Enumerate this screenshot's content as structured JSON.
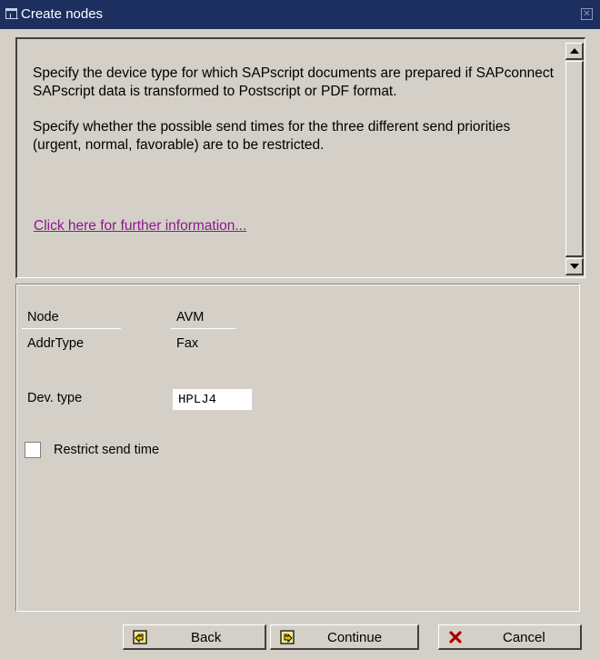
{
  "window": {
    "title": "Create nodes"
  },
  "info": {
    "paragraph1": "Specify the device type for which SAPscript documents are prepared if SAPconnect SAPscript data is transformed to Postscript or PDF format.",
    "paragraph2": "Specify whether the possible send times for the three different send priorities (urgent, normal, favorable) are to be restricted.",
    "link": "Click here for further information..."
  },
  "form": {
    "node_label": "Node",
    "node_value": "AVM",
    "addrtype_label": "AddrType",
    "addrtype_value": "Fax",
    "devtype_label": "Dev. type",
    "devtype_value": "HPLJ4",
    "restrict_label": "Restrict send time",
    "restrict_checked": false
  },
  "buttons": {
    "back": "Back",
    "continue": "Continue",
    "cancel": "Cancel"
  },
  "colors": {
    "titlebar": "#1c2f5f",
    "link": "#8a1a8a",
    "background": "#d4d0c8",
    "cancel_icon": "#cc0000"
  }
}
